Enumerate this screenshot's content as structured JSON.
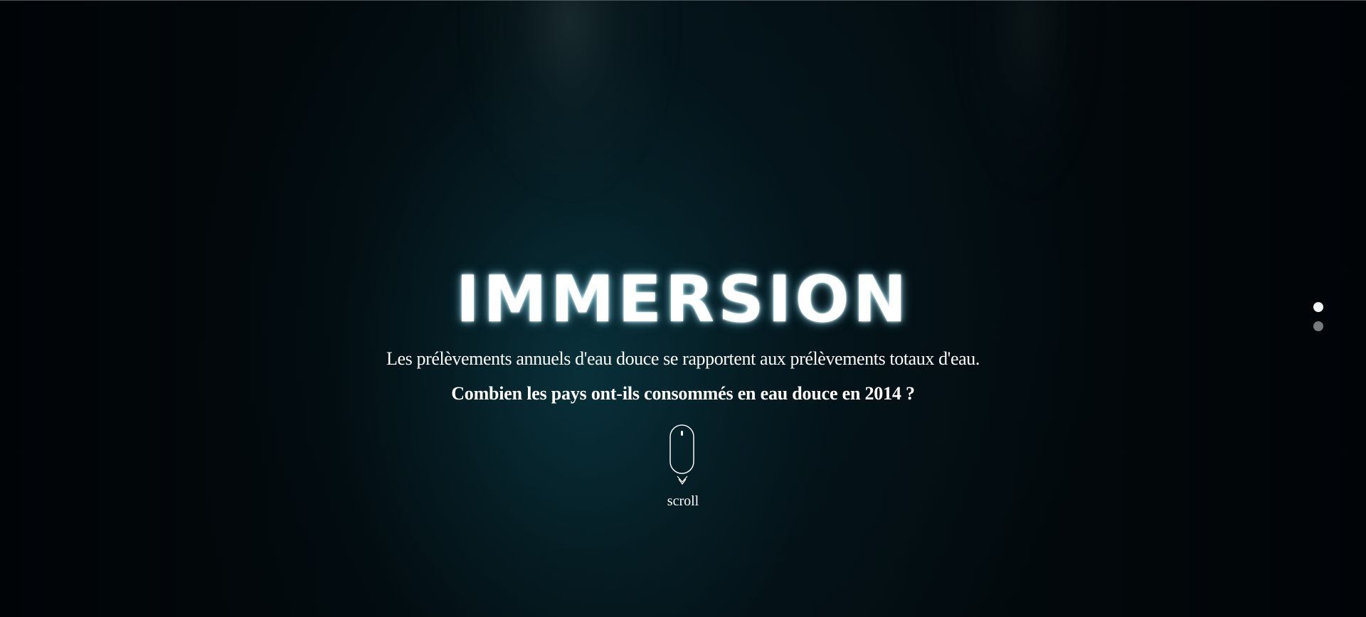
{
  "hero": {
    "title": "IMMERSION",
    "description": "Les prélèvements annuels d'eau douce se rapportent aux prélèvements totaux d'eau.",
    "question": "Combien les pays ont-ils consommés en eau douce en 2014 ?"
  },
  "scroll": {
    "label": "scroll",
    "icon": "mouse-icon",
    "arrow_icon": "double-chevron-down-icon"
  },
  "pagination": {
    "items": [
      {
        "state": "active"
      },
      {
        "state": "inactive"
      }
    ]
  },
  "colors": {
    "background": "#020507",
    "teal_glow": "#0a343e",
    "text": "#ffffff",
    "dot_active": "#f5f5f5",
    "dot_inactive": "#777b7d"
  }
}
